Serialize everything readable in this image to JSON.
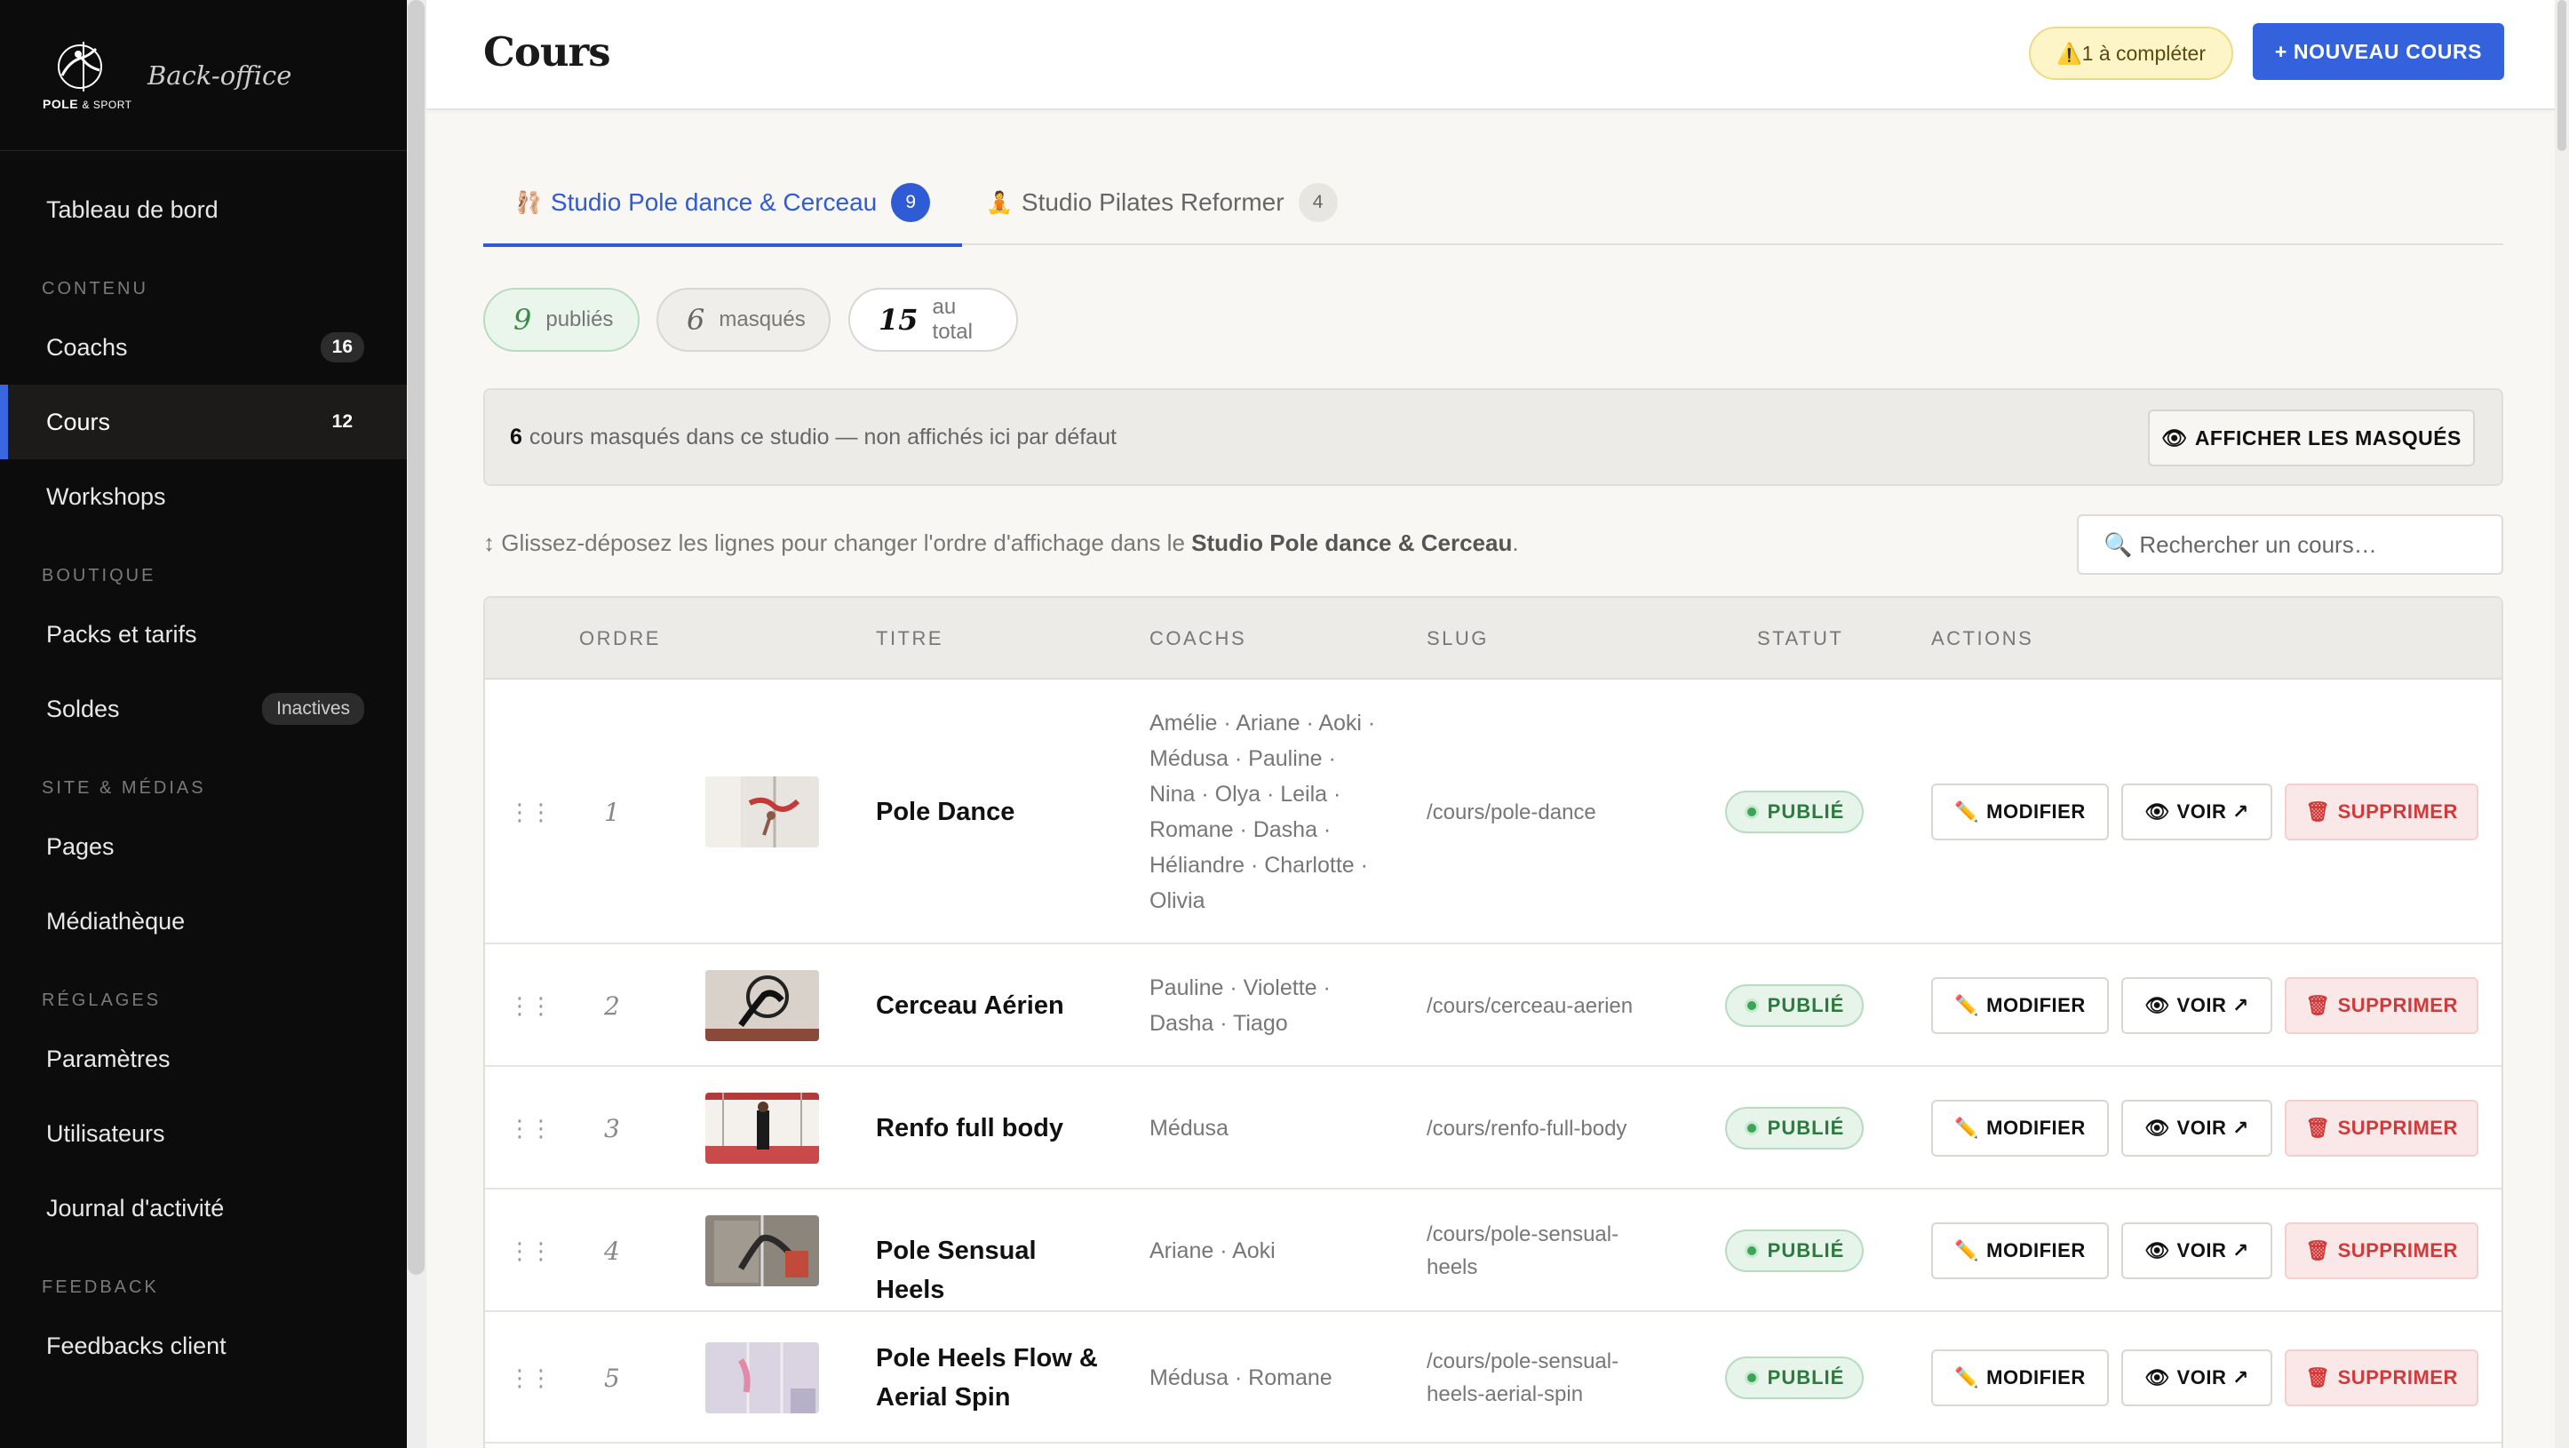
{
  "sidebar": {
    "logo_text_bold": "POLE",
    "logo_text_light": "& SPORT",
    "brand_title": "Back-office",
    "top_item": {
      "label": "Tableau de bord"
    },
    "sections": [
      {
        "label": "CONTENU",
        "items": [
          {
            "label": "Coachs",
            "badge": "16"
          },
          {
            "label": "Cours",
            "badge": "12",
            "active": true
          },
          {
            "label": "Workshops"
          }
        ]
      },
      {
        "label": "BOUTIQUE",
        "items": [
          {
            "label": "Packs et tarifs"
          },
          {
            "label": "Soldes",
            "badge": "Inactives"
          }
        ]
      },
      {
        "label": "SITE & MÉDIAS",
        "items": [
          {
            "label": "Pages"
          },
          {
            "label": "Médiathèque"
          }
        ]
      },
      {
        "label": "RÉGLAGES",
        "items": [
          {
            "label": "Paramètres"
          },
          {
            "label": "Utilisateurs"
          },
          {
            "label": "Journal d'activité"
          }
        ]
      },
      {
        "label": "FEEDBACK",
        "items": [
          {
            "label": "Feedbacks client"
          }
        ]
      }
    ]
  },
  "header": {
    "title": "Cours",
    "warn_icon": "⚠️",
    "warn_label": "1 à compléter",
    "new_button": "+ NOUVEAU COURS"
  },
  "tabs": [
    {
      "icon": "🩰",
      "label": "Studio Pole dance & Cerceau",
      "count": "9",
      "active": true
    },
    {
      "icon": "🧘",
      "label": "Studio Pilates Reformer",
      "count": "4",
      "active": false
    }
  ],
  "stats": [
    {
      "num": "9",
      "label": "publiés"
    },
    {
      "num": "6",
      "label": "masqués"
    },
    {
      "num": "15",
      "label": "au total"
    }
  ],
  "banner": {
    "count": "6",
    "text": "cours masqués dans ce studio — non affichés ici par défaut",
    "button_icon": "👁",
    "button": "AFFICHER LES MASQUÉS"
  },
  "hint": {
    "prefix": "↕ Glissez-déposez les lignes pour changer l'ordre d'affichage dans le",
    "studio": "Studio Pole dance & Cerceau",
    "suffix": "."
  },
  "search": {
    "icon": "🔍",
    "placeholder": "Rechercher un cours…"
  },
  "table": {
    "headers": [
      "ORDRE",
      "TITRE",
      "COACHS",
      "SLUG",
      "STATUT",
      "ACTIONS"
    ],
    "actions": {
      "edit_icon": "✏️",
      "edit": "MODIFIER",
      "view_icon": "👁",
      "view": "VOIR ↗",
      "delete_icon": "🗑",
      "delete": "SUPPRIMER"
    },
    "rows": [
      {
        "order": "1",
        "title_lines": [
          "Pole Dance"
        ],
        "coach_lines": [
          "Amélie · Ariane · Aoki ·",
          "Médusa · Pauline ·",
          "Nina · Olya · Leila ·",
          "Romane · Dasha ·",
          "Héliandre · Charlotte ·",
          "Olivia"
        ],
        "slug_lines": [
          "/cours/pole-dance"
        ],
        "status": "PUBLIÉ"
      },
      {
        "order": "2",
        "title_lines": [
          "Cerceau Aérien"
        ],
        "coach_lines": [
          "Pauline · Violette ·",
          "Dasha · Tiago"
        ],
        "slug_lines": [
          "/cours/cerceau-aerien"
        ],
        "status": "PUBLIÉ"
      },
      {
        "order": "3",
        "title_lines": [
          "Renfo full body"
        ],
        "coach_lines": [
          "Médusa"
        ],
        "slug_lines": [
          "/cours/renfo-full-body"
        ],
        "status": "PUBLIÉ"
      },
      {
        "order": "4",
        "title_lines": [
          "Pole Sensual Heels"
        ],
        "coach_lines": [
          "Ariane · Aoki"
        ],
        "slug_lines": [
          "/cours/pole-sensual-",
          "heels"
        ],
        "status": "PUBLIÉ"
      },
      {
        "order": "5",
        "title_lines": [
          "Pole Heels Flow &",
          "Aerial Spin"
        ],
        "coach_lines": [
          "Médusa · Romane"
        ],
        "slug_lines": [
          "/cours/pole-sensual-",
          "heels-aerial-spin"
        ],
        "status": "PUBLIÉ"
      }
    ]
  },
  "colors": {
    "accent": "#3462dc",
    "sidebar_bg": "#0c0c0c",
    "published": "#2d7a3f",
    "danger": "#d03a3a"
  }
}
